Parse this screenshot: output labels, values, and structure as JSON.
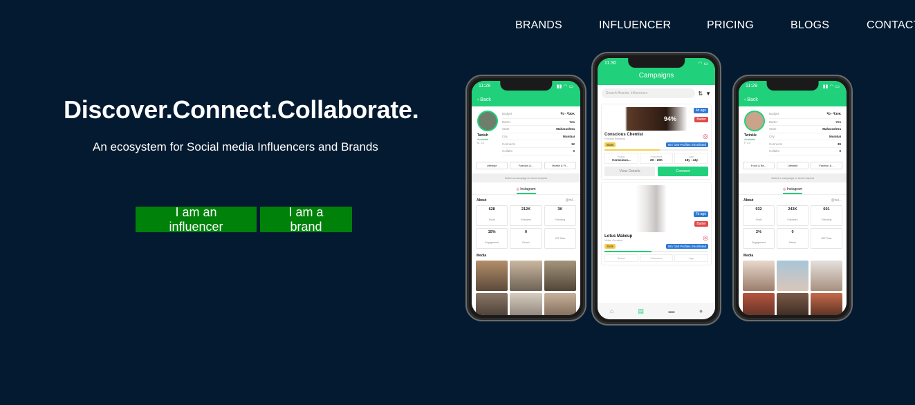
{
  "nav": {
    "items": [
      "BRANDS",
      "INFLUENCER",
      "PRICING",
      "BLOGS",
      "CONTACT"
    ]
  },
  "hero": {
    "title": "Discover.Connect.Collaborate.",
    "subtitle": "An ecosystem for Social media Influencers and Brands",
    "influencer_button": "I am an influencer",
    "brand_button": "I am a brand"
  },
  "colors": {
    "background": "#031a30",
    "button": "#00820a",
    "app_accent": "#20d07a"
  },
  "left_phone": {
    "time": "11:28",
    "back": "Back",
    "name": "Tanish",
    "status": "Available",
    "gender_age": "M, 22",
    "details": [
      {
        "k": "Budget",
        "v": "₹0 - ₹30K"
      },
      {
        "k": "Barter",
        "v": "Yes"
      },
      {
        "k": "State",
        "v": "Maharashtra"
      },
      {
        "k": "City",
        "v": "Mumbai"
      },
      {
        "k": "Connects",
        "v": "12"
      },
      {
        "k": "Collabs",
        "v": "0"
      }
    ],
    "chips": [
      "Lifestyle",
      "Fashion &...",
      "Health & Fi..."
    ],
    "select_campaign": "Select a campaign to send request",
    "tab": "Instagram",
    "about": "About",
    "handle": "@ml...",
    "stats": [
      {
        "v": "628",
        "l": "Posts"
      },
      {
        "v": "212K",
        "l": "Followers"
      },
      {
        "v": "3K",
        "l": "Following"
      },
      {
        "v": "15%",
        "l": "Engagement"
      },
      {
        "v": "0",
        "l": "Reach"
      },
      {
        "v": "",
        "l": "NFF Rate"
      }
    ],
    "media": "Media"
  },
  "mid_phone": {
    "time": "11:30",
    "title": "Campaigns",
    "search_placeholder": "Search Brands, Influencers",
    "cards": [
      {
        "age_badge": "6d ago",
        "type_badge": "Barter",
        "brand": "Conscious Chemist",
        "category": "Product Reviews",
        "slots": "Slots",
        "shortlisted": "80 / 150 Profiles Shortlisted",
        "cells": [
          {
            "l": "Brand",
            "v": "Conscious..."
          },
          {
            "l": "Followers",
            "v": "2K - 20K"
          },
          {
            "l": "Age",
            "v": "18y - 44y"
          }
        ],
        "view": "View Details",
        "connect": "Connect",
        "percent": "94%"
      },
      {
        "age_badge": "7d ago",
        "type_badge": "Barter",
        "brand": "Lotus Makeup",
        "category": "Video Creation",
        "slots": "Slots",
        "shortlisted": "68 / 150 Profiles Shortlisted",
        "cells": [
          {
            "l": "Brand",
            "v": ""
          },
          {
            "l": "Followers",
            "v": ""
          },
          {
            "l": "Age",
            "v": ""
          }
        ]
      }
    ]
  },
  "right_phone": {
    "time": "11:29",
    "back": "Back",
    "name": "Twinkle",
    "status": "Available",
    "gender_age": "F, 23",
    "details": [
      {
        "k": "Budget",
        "v": "₹0 - ₹30K"
      },
      {
        "k": "Barter",
        "v": "Yes"
      },
      {
        "k": "State",
        "v": "Maharashtra"
      },
      {
        "k": "City",
        "v": "Mumbai"
      },
      {
        "k": "Connects",
        "v": "39"
      },
      {
        "k": "Collabs",
        "v": "0"
      }
    ],
    "chips": [
      "Food & Be...",
      "Lifestyle",
      "Fashion &..."
    ],
    "select_campaign": "Select a campaign to send request",
    "tab": "Instagram",
    "about": "About",
    "handle": "@twi...",
    "stats": [
      {
        "v": "932",
        "l": "Posts"
      },
      {
        "v": "243K",
        "l": "Followers"
      },
      {
        "v": "601",
        "l": "Following"
      },
      {
        "v": "2%",
        "l": "Engagement"
      },
      {
        "v": "0",
        "l": "Reach"
      },
      {
        "v": "",
        "l": "NFF Rate"
      }
    ],
    "media": "Media"
  }
}
